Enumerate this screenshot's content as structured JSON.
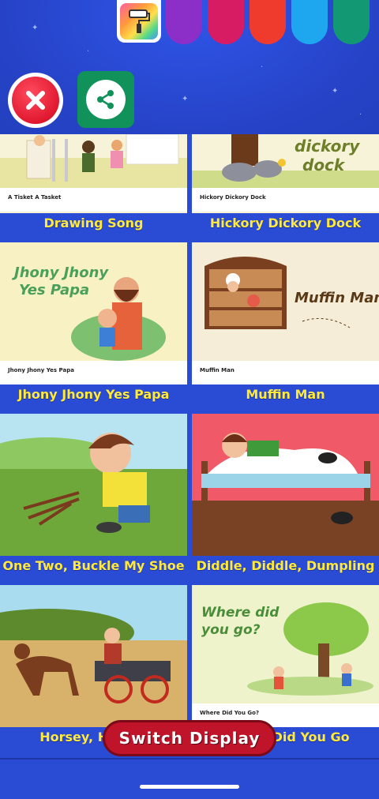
{
  "toolbar": {
    "palette_colors": [
      "#8c2fc9",
      "#d81c63",
      "#ef3b2d",
      "#1ea7ef",
      "#129873"
    ],
    "close_icon": "close-icon",
    "share_icon": "share-icon",
    "paint_icon": "paint-roller-icon"
  },
  "cards": [
    {
      "title": "Drawing Song",
      "caption": "A Tisket A Tasket"
    },
    {
      "title": "Hickory Dickory Dock",
      "caption": "Hickory Dickory Dock",
      "art_text": "Hickory Dickory dock"
    },
    {
      "title": "Jhony Jhony Yes Papa",
      "caption": "Jhony Jhony Yes Papa",
      "art_text": "Jhony Jhony Yes Papa"
    },
    {
      "title": "Muffin Man",
      "caption": "Muffin Man",
      "art_text": "Muffin Man"
    },
    {
      "title": "One Two, Buckle My Shoe"
    },
    {
      "title": "Diddle, Diddle, Dumpling"
    },
    {
      "title": "Horsey, Horsey"
    },
    {
      "title": "Where Did You Go",
      "caption": "Where Did You Go?",
      "art_text": "Where did you go?"
    }
  ],
  "switch_display_label": "Switch Display"
}
